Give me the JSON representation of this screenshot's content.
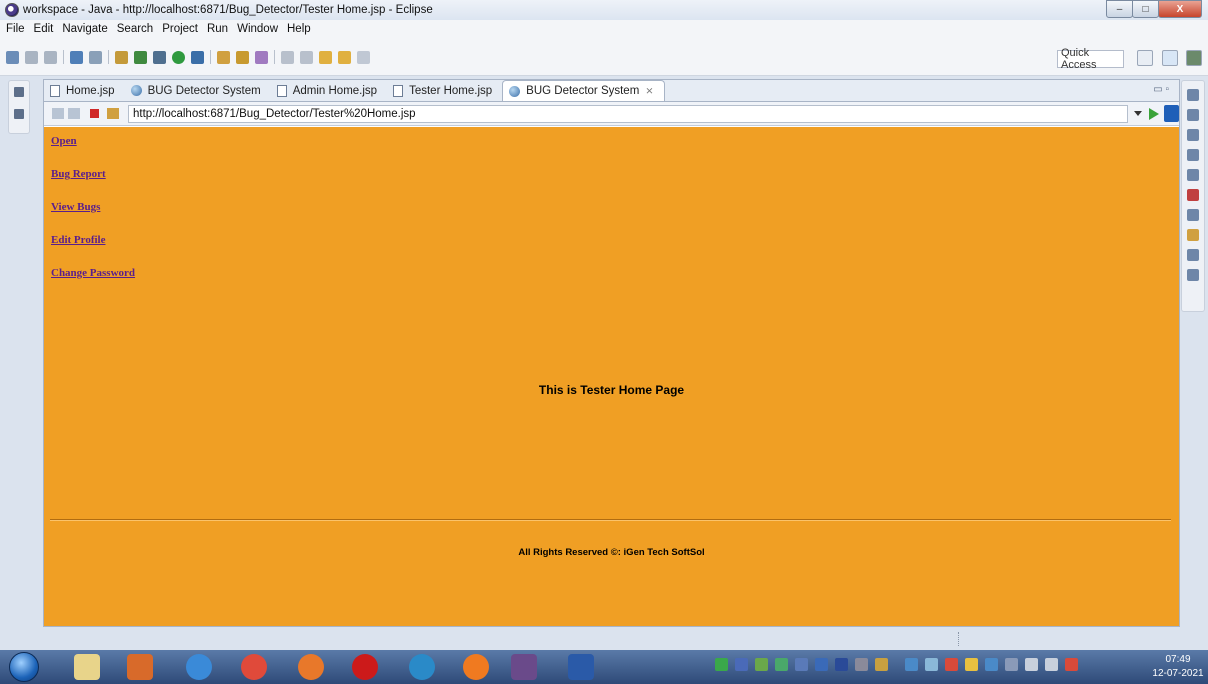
{
  "window": {
    "title": "workspace - Java - http://localhost:6871/Bug_Detector/Tester Home.jsp - Eclipse",
    "min": "–",
    "max": "□",
    "close": "X"
  },
  "menu": [
    "File",
    "Edit",
    "Navigate",
    "Search",
    "Project",
    "Run",
    "Window",
    "Help"
  ],
  "toolbar": {
    "quick_access": "Quick Access"
  },
  "tabs": [
    {
      "label": "Home.jsp",
      "icon": "jsp-file-icon"
    },
    {
      "label": "BUG Detector System",
      "icon": "globe-icon"
    },
    {
      "label": "Admin Home.jsp",
      "icon": "jsp-file-icon"
    },
    {
      "label": "Tester Home.jsp",
      "icon": "jsp-file-icon"
    },
    {
      "label": "BUG Detector System",
      "icon": "globe-icon",
      "close": "⨯"
    }
  ],
  "browser": {
    "url": "http://localhost:6871/Bug_Detector/Tester%20Home.jsp"
  },
  "page": {
    "links": [
      "Open",
      "Bug Report",
      "View Bugs",
      "Edit Profile",
      "Change Password"
    ],
    "heading": "This is Tester Home Page",
    "footer": "All Rights Reserved ©: iGen Tech SoftSol",
    "bg_color": "#f09f24"
  },
  "taskbar": {
    "time": "07:49",
    "date": "12-07-2021"
  }
}
